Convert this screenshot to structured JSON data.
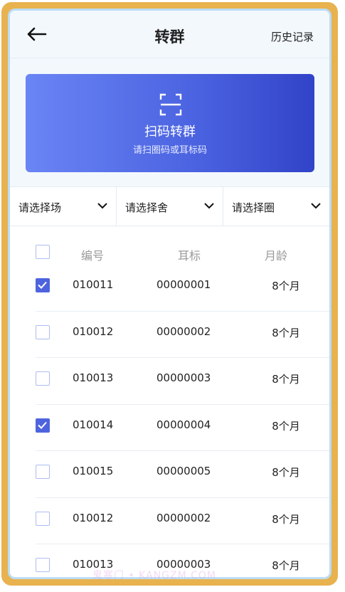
{
  "header": {
    "title": "转群",
    "history_label": "历史记录"
  },
  "scan": {
    "title": "扫码转群",
    "subtitle": "请扫圈码或耳标码"
  },
  "filters": [
    "请选择场",
    "请选择舍",
    "请选择圈"
  ],
  "table": {
    "headers": {
      "number": "编号",
      "ear_tag": "耳标",
      "age": "月龄"
    },
    "rows": [
      {
        "checked": true,
        "number": "010011",
        "ear_tag": "00000001",
        "age": "8个月"
      },
      {
        "checked": false,
        "number": "010012",
        "ear_tag": "00000002",
        "age": "8个月"
      },
      {
        "checked": false,
        "number": "010013",
        "ear_tag": "00000003",
        "age": "8个月"
      },
      {
        "checked": true,
        "number": "010014",
        "ear_tag": "00000004",
        "age": "8个月"
      },
      {
        "checked": false,
        "number": "010015",
        "ear_tag": "00000005",
        "age": "8个月"
      },
      {
        "checked": false,
        "number": "010012",
        "ear_tag": "00000002",
        "age": "8个月"
      },
      {
        "checked": false,
        "number": "010013",
        "ear_tag": "00000003",
        "age": "8个月"
      }
    ]
  },
  "watermark": "鬼寒门 • KANGZM.COM",
  "colors": {
    "accent": "#4e64de",
    "frame": "#e8b24e",
    "frame_inner": "#bcdcf5"
  }
}
